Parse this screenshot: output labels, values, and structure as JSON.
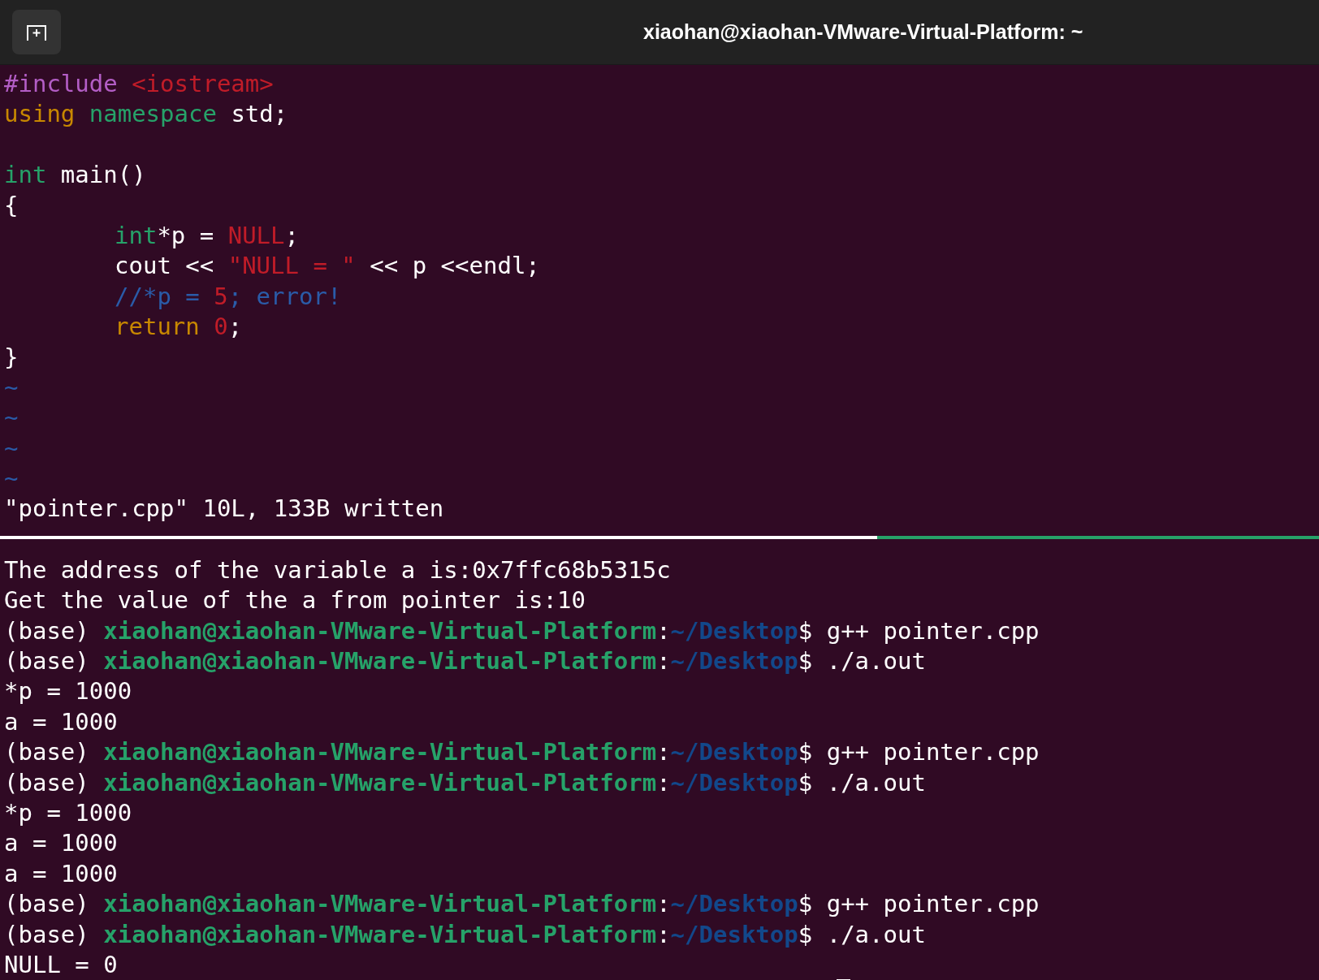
{
  "window": {
    "title": "xiaohan@xiaohan-VMware-Virtual-Platform: ~"
  },
  "editor": {
    "lines": [
      {
        "kind": "code",
        "indented": false,
        "segments": [
          {
            "kind": "preproc",
            "text": "#include"
          },
          {
            "kind": "constant",
            "text": " <iostream>"
          }
        ]
      },
      {
        "kind": "code",
        "indented": false,
        "segments": [
          {
            "kind": "statement",
            "text": "using"
          },
          {
            "kind": "type",
            "text": " namespace"
          },
          {
            "kind": "plain",
            "text": " std;"
          }
        ]
      },
      {
        "kind": "blank"
      },
      {
        "kind": "code",
        "indented": false,
        "segments": [
          {
            "kind": "type",
            "text": "int"
          },
          {
            "kind": "plain",
            "text": " main()"
          }
        ]
      },
      {
        "kind": "code",
        "indented": false,
        "segments": [
          {
            "kind": "plain",
            "text": "{"
          }
        ]
      },
      {
        "kind": "code",
        "indented": true,
        "segments": [
          {
            "kind": "type",
            "text": "int"
          },
          {
            "kind": "plain",
            "text": "*p = "
          },
          {
            "kind": "constant",
            "text": "NULL"
          },
          {
            "kind": "plain",
            "text": ";"
          }
        ]
      },
      {
        "kind": "code",
        "indented": true,
        "segments": [
          {
            "kind": "plain",
            "text": "cout << "
          },
          {
            "kind": "constant",
            "text": "\"NULL = \""
          },
          {
            "kind": "plain",
            "text": " << p <<endl;"
          }
        ]
      },
      {
        "kind": "code",
        "indented": true,
        "segments": [
          {
            "kind": "comment",
            "text": "//*p = "
          },
          {
            "kind": "constant",
            "text": "5"
          },
          {
            "kind": "comment",
            "text": "; error!"
          }
        ]
      },
      {
        "kind": "code",
        "indented": true,
        "segments": [
          {
            "kind": "statement",
            "text": "return"
          },
          {
            "kind": "constant",
            "text": " 0"
          },
          {
            "kind": "plain",
            "text": ";"
          }
        ]
      },
      {
        "kind": "code",
        "indented": false,
        "segments": [
          {
            "kind": "plain",
            "text": "}"
          }
        ]
      }
    ],
    "empty_markers": [
      "~",
      "~",
      "~",
      "~"
    ],
    "status": "\"pointer.cpp\" 10L, 133B written"
  },
  "terminal": {
    "lines": [
      [
        {
          "kind": "plain",
          "text": "The address of the variable a is:0x7ffc68b5315c"
        }
      ],
      [
        {
          "kind": "plain",
          "text": "Get the value of the a from pointer is:10"
        }
      ],
      [
        {
          "kind": "plain",
          "text": "(base) "
        },
        {
          "kind": "user",
          "text": "xiaohan@xiaohan-VMware-Virtual-Platform"
        },
        {
          "kind": "plain",
          "text": ":"
        },
        {
          "kind": "path",
          "text": "~/Desktop"
        },
        {
          "kind": "plain",
          "text": "$ g++ pointer.cpp"
        }
      ],
      [
        {
          "kind": "plain",
          "text": "(base) "
        },
        {
          "kind": "user",
          "text": "xiaohan@xiaohan-VMware-Virtual-Platform"
        },
        {
          "kind": "plain",
          "text": ":"
        },
        {
          "kind": "path",
          "text": "~/Desktop"
        },
        {
          "kind": "plain",
          "text": "$ ./a.out"
        }
      ],
      [
        {
          "kind": "plain",
          "text": "*p = 1000"
        }
      ],
      [
        {
          "kind": "plain",
          "text": "a = 1000"
        }
      ],
      [
        {
          "kind": "plain",
          "text": "(base) "
        },
        {
          "kind": "user",
          "text": "xiaohan@xiaohan-VMware-Virtual-Platform"
        },
        {
          "kind": "plain",
          "text": ":"
        },
        {
          "kind": "path",
          "text": "~/Desktop"
        },
        {
          "kind": "plain",
          "text": "$ g++ pointer.cpp"
        }
      ],
      [
        {
          "kind": "plain",
          "text": "(base) "
        },
        {
          "kind": "user",
          "text": "xiaohan@xiaohan-VMware-Virtual-Platform"
        },
        {
          "kind": "plain",
          "text": ":"
        },
        {
          "kind": "path",
          "text": "~/Desktop"
        },
        {
          "kind": "plain",
          "text": "$ ./a.out"
        }
      ],
      [
        {
          "kind": "plain",
          "text": "*p = 1000"
        }
      ],
      [
        {
          "kind": "plain",
          "text": "a = 1000"
        }
      ],
      [
        {
          "kind": "plain",
          "text": "a = 1000"
        }
      ],
      [
        {
          "kind": "plain",
          "text": "(base) "
        },
        {
          "kind": "user",
          "text": "xiaohan@xiaohan-VMware-Virtual-Platform"
        },
        {
          "kind": "plain",
          "text": ":"
        },
        {
          "kind": "path",
          "text": "~/Desktop"
        },
        {
          "kind": "plain",
          "text": "$ g++ pointer.cpp"
        }
      ],
      [
        {
          "kind": "plain",
          "text": "(base) "
        },
        {
          "kind": "user",
          "text": "xiaohan@xiaohan-VMware-Virtual-Platform"
        },
        {
          "kind": "plain",
          "text": ":"
        },
        {
          "kind": "path",
          "text": "~/Desktop"
        },
        {
          "kind": "plain",
          "text": "$ ./a.out"
        }
      ],
      [
        {
          "kind": "plain",
          "text": "NULL = 0"
        }
      ]
    ]
  }
}
